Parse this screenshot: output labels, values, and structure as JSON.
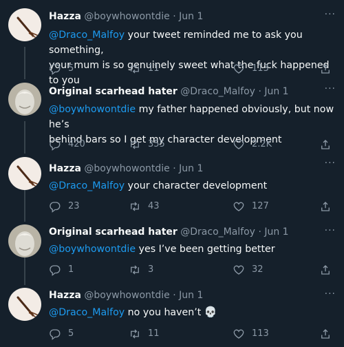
{
  "tweets": [
    {
      "name": "Hazza",
      "handle": "@boywhowontdie",
      "date": "· Jun 1",
      "mention": "@Draco_Malfoy",
      "text": " your tweet reminded me to ask you something,",
      "text2": "your mum is so genuinely sweet what the fuck happened to you",
      "replies": "5",
      "retweets": "11",
      "likes": "113",
      "avatar": "hazza"
    },
    {
      "name": "Original scarhead hater",
      "handle": "@Draco_Malfoy",
      "date": "· Jun 1",
      "mention": "@boywhowontdie",
      "text": " my father happened obviously, but now he’s",
      "text2": "behind bars so I get my character development",
      "replies": "420",
      "retweets": "355",
      "likes": "2.2K",
      "avatar": "draco"
    },
    {
      "name": "Hazza",
      "handle": "@boywhowontdie",
      "date": "· Jun 1",
      "mention": "@Draco_Malfoy",
      "text": " your character development",
      "replies": "23",
      "retweets": "43",
      "likes": "127",
      "avatar": "hazza"
    },
    {
      "name": "Original scarhead hater",
      "handle": "@Draco_Malfoy",
      "date": "· Jun 1",
      "mention": "@boywhowontdie",
      "text": " yes I’ve been getting better",
      "replies": "1",
      "retweets": "3",
      "likes": "32",
      "avatar": "draco"
    },
    {
      "name": "Hazza",
      "handle": "@boywhowontdie",
      "date": "· Jun 1",
      "mention": "@Draco_Malfoy",
      "text": " no you haven’t",
      "emoji": "💀",
      "replies": "5",
      "retweets": "11",
      "likes": "113",
      "avatar": "hazza"
    }
  ],
  "icons": {
    "reply": "reply-icon",
    "retweet": "retweet-icon",
    "like": "heart-icon",
    "share": "share-icon",
    "more": "more-icon",
    "skull": "skull-emoji"
  },
  "more_glyph": "···",
  "colors": {
    "background": "#15202b",
    "link": "#1d9bf0",
    "muted": "#8b98a5",
    "text": "#f7f9f9"
  }
}
